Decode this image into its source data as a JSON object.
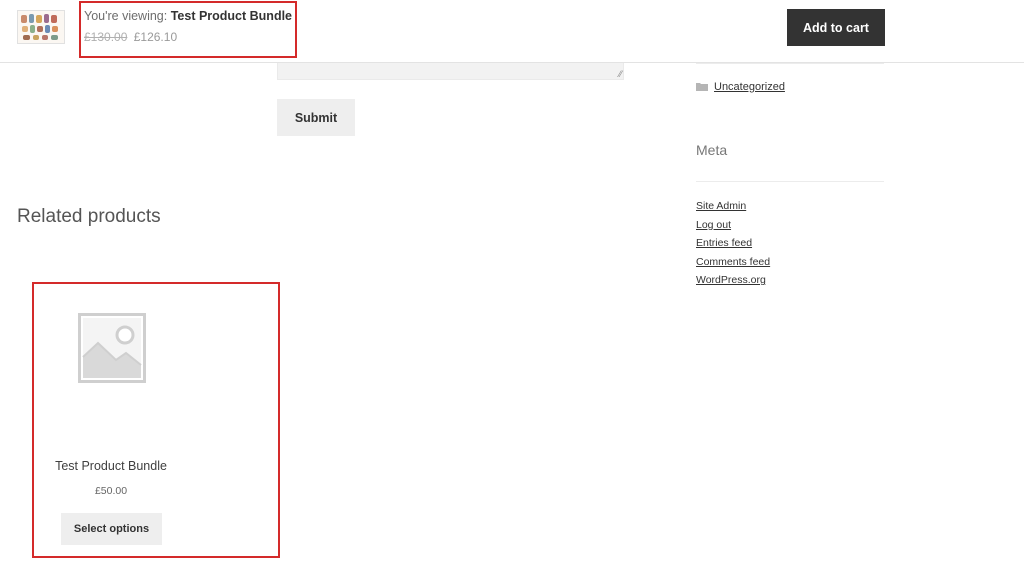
{
  "sticky_bar": {
    "viewing_prefix": "You're viewing: ",
    "product_name": "Test Product Bundle",
    "price_old": "£130.00",
    "price_new": "£126.10",
    "add_to_cart_label": "Add to cart",
    "thumbnail_icon": "product-thumbnail"
  },
  "comment_form": {
    "submit_label": "Submit"
  },
  "related": {
    "title": "Related products",
    "products": [
      {
        "name": "Test Product Bundle",
        "price": "£50.00",
        "button_label": "Select options",
        "image_icon": "placeholder-image-icon"
      }
    ]
  },
  "sidebar": {
    "category_link": "Uncategorized",
    "meta_title": "Meta",
    "meta_links": [
      "Site Admin",
      "Log out",
      "Entries feed",
      "Comments feed",
      "WordPress.org"
    ]
  },
  "colors": {
    "highlight": "#d42a2a",
    "dark_button": "#333333",
    "light_button": "#eeeeee"
  }
}
